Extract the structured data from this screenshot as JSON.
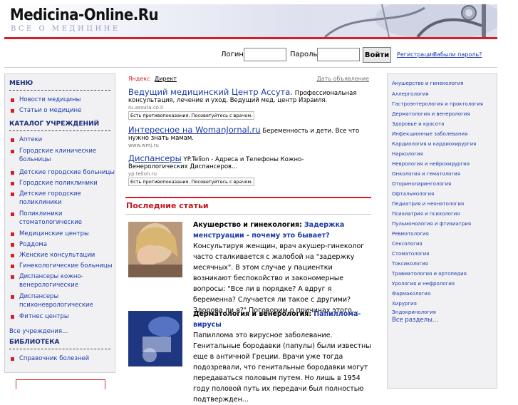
{
  "header": {
    "logo_title": "Medicina-Online.Ru",
    "logo_subtitle": "ВСЕ О МЕДИЦИНЕ"
  },
  "login": {
    "login_label": "Логин",
    "password_label": "Пароль",
    "submit": "Войти",
    "register": "Регистрация",
    "forgot": "Забыли пароль?"
  },
  "left": {
    "menu_title": "МЕНЮ",
    "menu_items": [
      "Новости медицины",
      "Статьи о медицине"
    ],
    "catalog_title": "КАТАЛОГ УЧРЕЖДЕНИЙ",
    "catalog_items": [
      "Аптеки",
      "Городские клинические больницы",
      "Детские городские больницы",
      "Городские поликлиники",
      "Детские городские поликлиники",
      "Поликлиники стоматологические",
      "Медицинские центры",
      "Роддома",
      "Женские консультации",
      "Гинекологические больницы",
      "Диспансеры кожно-венерологические",
      "Диспансеры психоневрологические",
      "Фитнес центры"
    ],
    "all_institutions": "Все учреждения...",
    "library_title": "БИБЛИОТЕКА",
    "library_items": [
      "Справочник болезней"
    ]
  },
  "ads": {
    "yandex_label": "Яндекс",
    "direct_label": "Директ",
    "place_ad": "Дать объявление",
    "items": [
      {
        "title": "Ведущий медицинский Центр Ассута.",
        "text": "Профессиональная консультация, лечение и уход. Ведущий мед. центр Израиля.",
        "url": "ru.assuta.co.il",
        "warning": "Есть противопоказания. Посоветуйтесь с врачом."
      },
      {
        "title": "Интересное на WomanJornal.ru",
        "text": "Беременность и дети. Все что нужно знать мамам.",
        "url": "www.wmj.ru",
        "warning": ""
      },
      {
        "title": "Диспансеры",
        "text": "YP.Telion - Адреса и Телефоны Кожно-Венерологических Диспансеров...",
        "url": "yp.telion.ru",
        "warning": "Есть противопоказания. Посоветуйтесь с врачом."
      }
    ]
  },
  "latest": {
    "title": "Последние статьи",
    "articles": [
      {
        "category": "Акушерство и гинекология:",
        "headline": "Задержка менструации - почему это бывает?",
        "body": "Консультируя женщин, врач акушер-гинеколог часто сталкивается с жалобой на \"задержку месячных\". В этом случае у пациентки возникают беспокойство и закономерные вопросы: \"Все ли в порядке? А вдруг я беременна? Случается ли такое с другими? Здорова ли я?\" Поговорим о причинах этого..."
      },
      {
        "category": "Дерматология и венерология:",
        "headline": "Папиллома-вирусы",
        "body": "Папиллома это вирусное заболевание. Генитальные бородавки (папулы) были известны еще в античной Греции. Врачи уже тогда подозревали, что генитальные бородавки могут передаваться половым путем. Но лишь в 1954 году половой путь их передачи был полностью подтвержден..."
      }
    ]
  },
  "right": {
    "items": [
      "Акушерство и гинекология",
      "Аллергология",
      "Гастроэнтерология и проктология",
      "Дерматология и венерология",
      "Здоровье и красота",
      "Инфекционные заболевания",
      "Кардиология и кардиохирургия",
      "Наркология",
      "Неврология и нейрохирургия",
      "Онкология и гематология",
      "Оториноларингология",
      "Офтальмология",
      "Педиатрия и неонатология",
      "Психиатрия и психология",
      "Пульмонология и фтизиатрия",
      "Ревматология",
      "Сексология",
      "Стоматология",
      "Токсикология",
      "Травматология и ортопедия",
      "Урология и нефрология",
      "Фармакология",
      "Хирургия",
      "Эндокринология"
    ],
    "all_sections": "Все разделы..."
  }
}
